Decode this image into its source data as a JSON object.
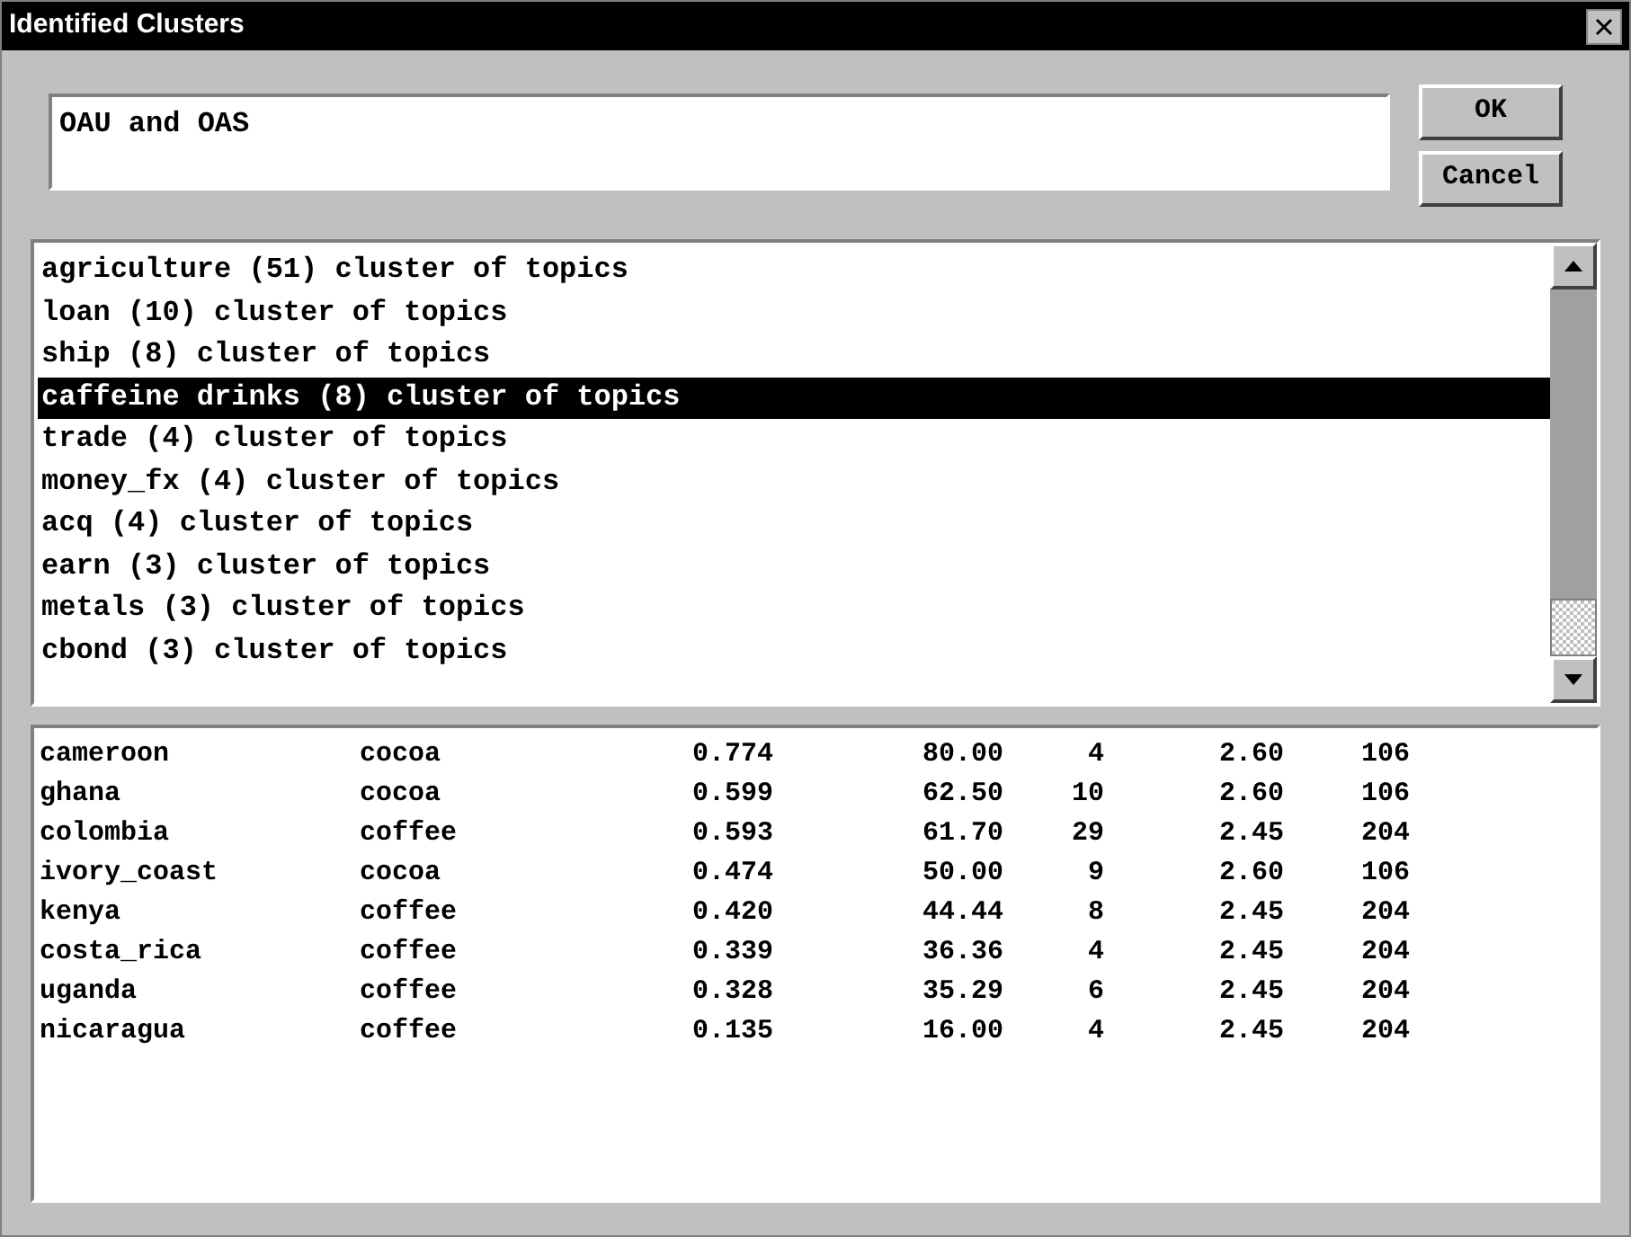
{
  "window": {
    "title": "Identified Clusters"
  },
  "name_field": {
    "value": "OAU and OAS"
  },
  "buttons": [
    "OK",
    "Cancel"
  ],
  "clusters": [
    {
      "label": "agriculture (51) cluster of topics",
      "selected": false
    },
    {
      "label": "loan (10) cluster of topics",
      "selected": false
    },
    {
      "label": "ship (8) cluster of topics",
      "selected": false
    },
    {
      "label": "caffeine drinks (8) cluster of topics",
      "selected": true
    },
    {
      "label": "trade (4) cluster of topics",
      "selected": false
    },
    {
      "label": "money_fx (4) cluster of topics",
      "selected": false
    },
    {
      "label": "acq (4) cluster of topics",
      "selected": false
    },
    {
      "label": "earn (3) cluster of topics",
      "selected": false
    },
    {
      "label": "metals (3) cluster of topics",
      "selected": false
    },
    {
      "label": "cbond (3) cluster of topics",
      "selected": false
    }
  ],
  "table": {
    "rows": [
      [
        "cameroon",
        "cocoa",
        "0.774",
        "80.00",
        "4",
        "2.60",
        "106"
      ],
      [
        "ghana",
        "cocoa",
        "0.599",
        "62.50",
        "10",
        "2.60",
        "106"
      ],
      [
        "colombia",
        "coffee",
        "0.593",
        "61.70",
        "29",
        "2.45",
        "204"
      ],
      [
        "ivory_coast",
        "cocoa",
        "0.474",
        "50.00",
        "9",
        "2.60",
        "106"
      ],
      [
        "kenya",
        "coffee",
        "0.420",
        "44.44",
        "8",
        "2.45",
        "204"
      ],
      [
        "costa_rica",
        "coffee",
        "0.339",
        "36.36",
        "4",
        "2.45",
        "204"
      ],
      [
        "uganda",
        "coffee",
        "0.328",
        "35.29",
        "6",
        "2.45",
        "204"
      ],
      [
        "nicaragua",
        "coffee",
        "0.135",
        "16.00",
        "4",
        "2.45",
        "204"
      ]
    ]
  }
}
